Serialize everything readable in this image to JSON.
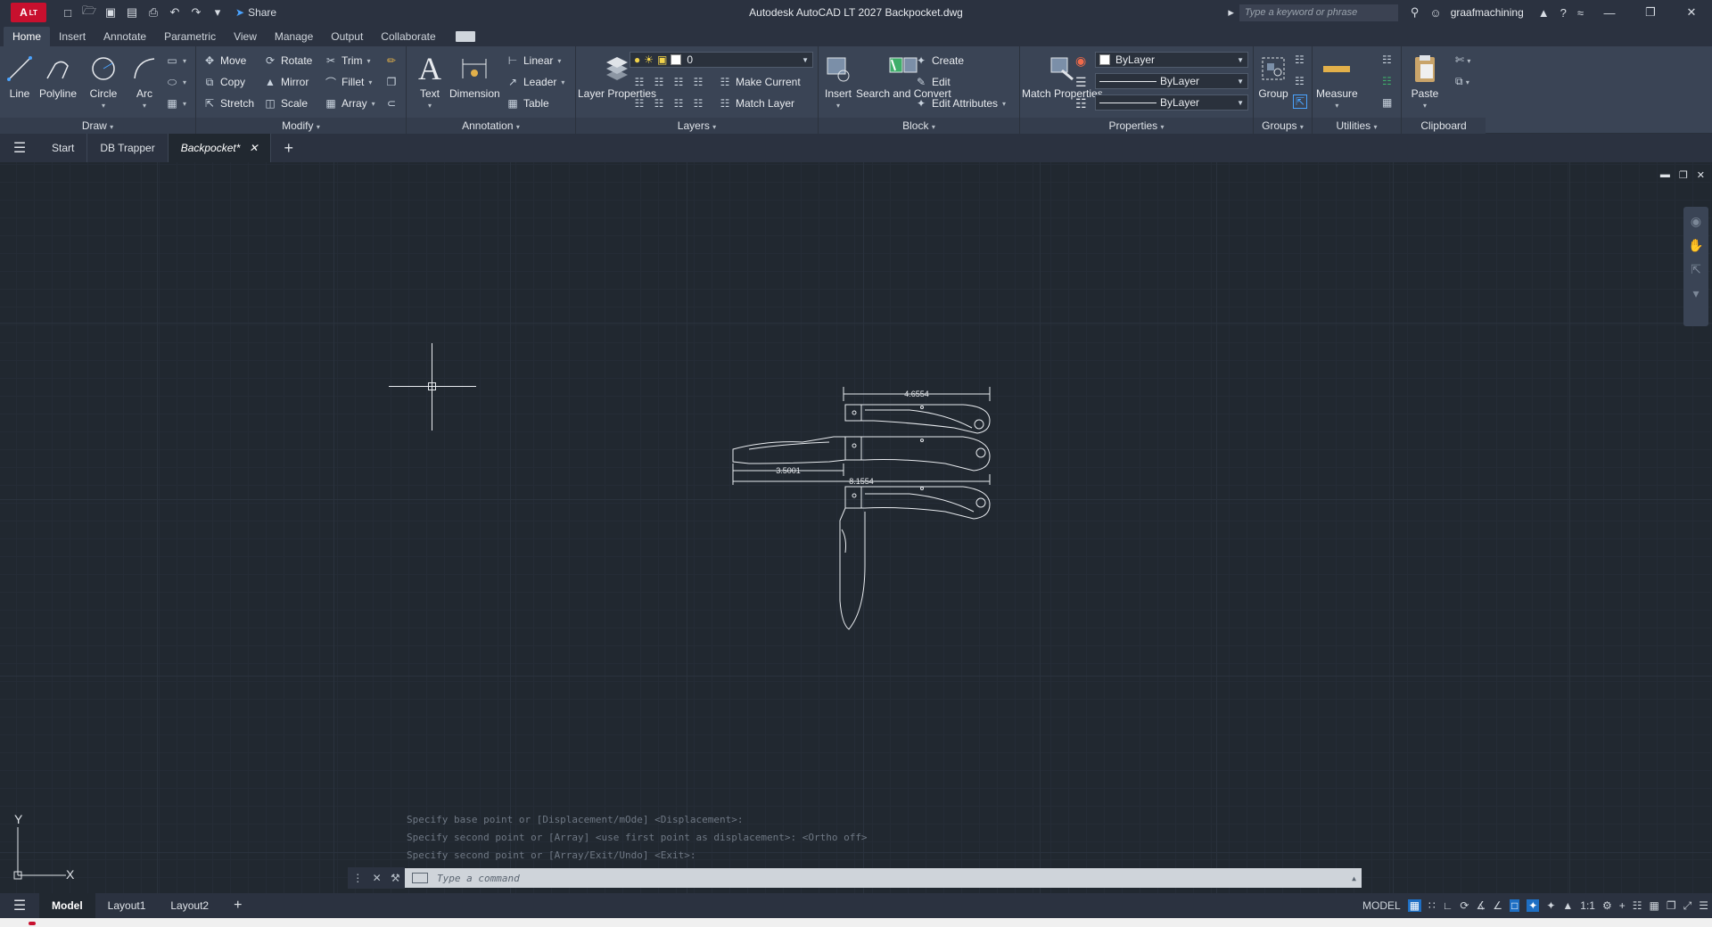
{
  "titlebar": {
    "app_logo": "A",
    "app_edition": "LT",
    "share_label": "Share",
    "title": "Autodesk AutoCAD LT 2027    Backpocket.dwg",
    "search_placeholder": "Type a keyword or phrase",
    "username": "graafmachining"
  },
  "ribbon_tabs": [
    "Home",
    "Insert",
    "Annotate",
    "Parametric",
    "View",
    "Manage",
    "Output",
    "Collaborate"
  ],
  "ribbon": {
    "draw": {
      "title": "Draw",
      "line": "Line",
      "polyline": "Polyline",
      "circle": "Circle",
      "arc": "Arc"
    },
    "modify": {
      "title": "Modify",
      "move": "Move",
      "rotate": "Rotate",
      "trim": "Trim",
      "copy": "Copy",
      "mirror": "Mirror",
      "fillet": "Fillet",
      "stretch": "Stretch",
      "scale": "Scale",
      "array": "Array"
    },
    "annotation": {
      "title": "Annotation",
      "text": "Text",
      "dimension": "Dimension",
      "linear": "Linear",
      "leader": "Leader",
      "table": "Table"
    },
    "layers": {
      "title": "Layers",
      "properties": "Layer Properties",
      "current_layer": "0",
      "make_current": "Make Current",
      "match_layer": "Match Layer"
    },
    "block": {
      "title": "Block",
      "insert": "Insert",
      "search_convert": "Search and Convert",
      "create": "Create",
      "edit": "Edit",
      "edit_attributes": "Edit Attributes"
    },
    "properties": {
      "title": "Properties",
      "match": "Match Properties",
      "color": "ByLayer",
      "linetype": "ByLayer",
      "lineweight": "ByLayer"
    },
    "groups": {
      "title": "Groups",
      "group": "Group"
    },
    "utilities": {
      "title": "Utilities",
      "measure": "Measure"
    },
    "clipboard": {
      "title": "Clipboard",
      "paste": "Paste"
    }
  },
  "file_tabs": [
    "Start",
    "DB Trapper",
    "Backpocket*"
  ],
  "drawing": {
    "dim_top": "4.6554",
    "dim_blade": "3.5001",
    "dim_overall": "8.1554"
  },
  "ucs": {
    "y": "Y",
    "x": "X"
  },
  "command": {
    "history": [
      "Specify base point or [Displacement/mOde] <Displacement>:",
      "Specify second point or [Array] <use first point as displacement>:  <Ortho off>",
      "Specify second point or [Array/Exit/Undo] <Exit>:"
    ],
    "placeholder": "Type a command"
  },
  "layout_tabs": [
    "Model",
    "Layout1",
    "Layout2"
  ],
  "status": {
    "mode": "MODEL",
    "scale": "1:1"
  }
}
